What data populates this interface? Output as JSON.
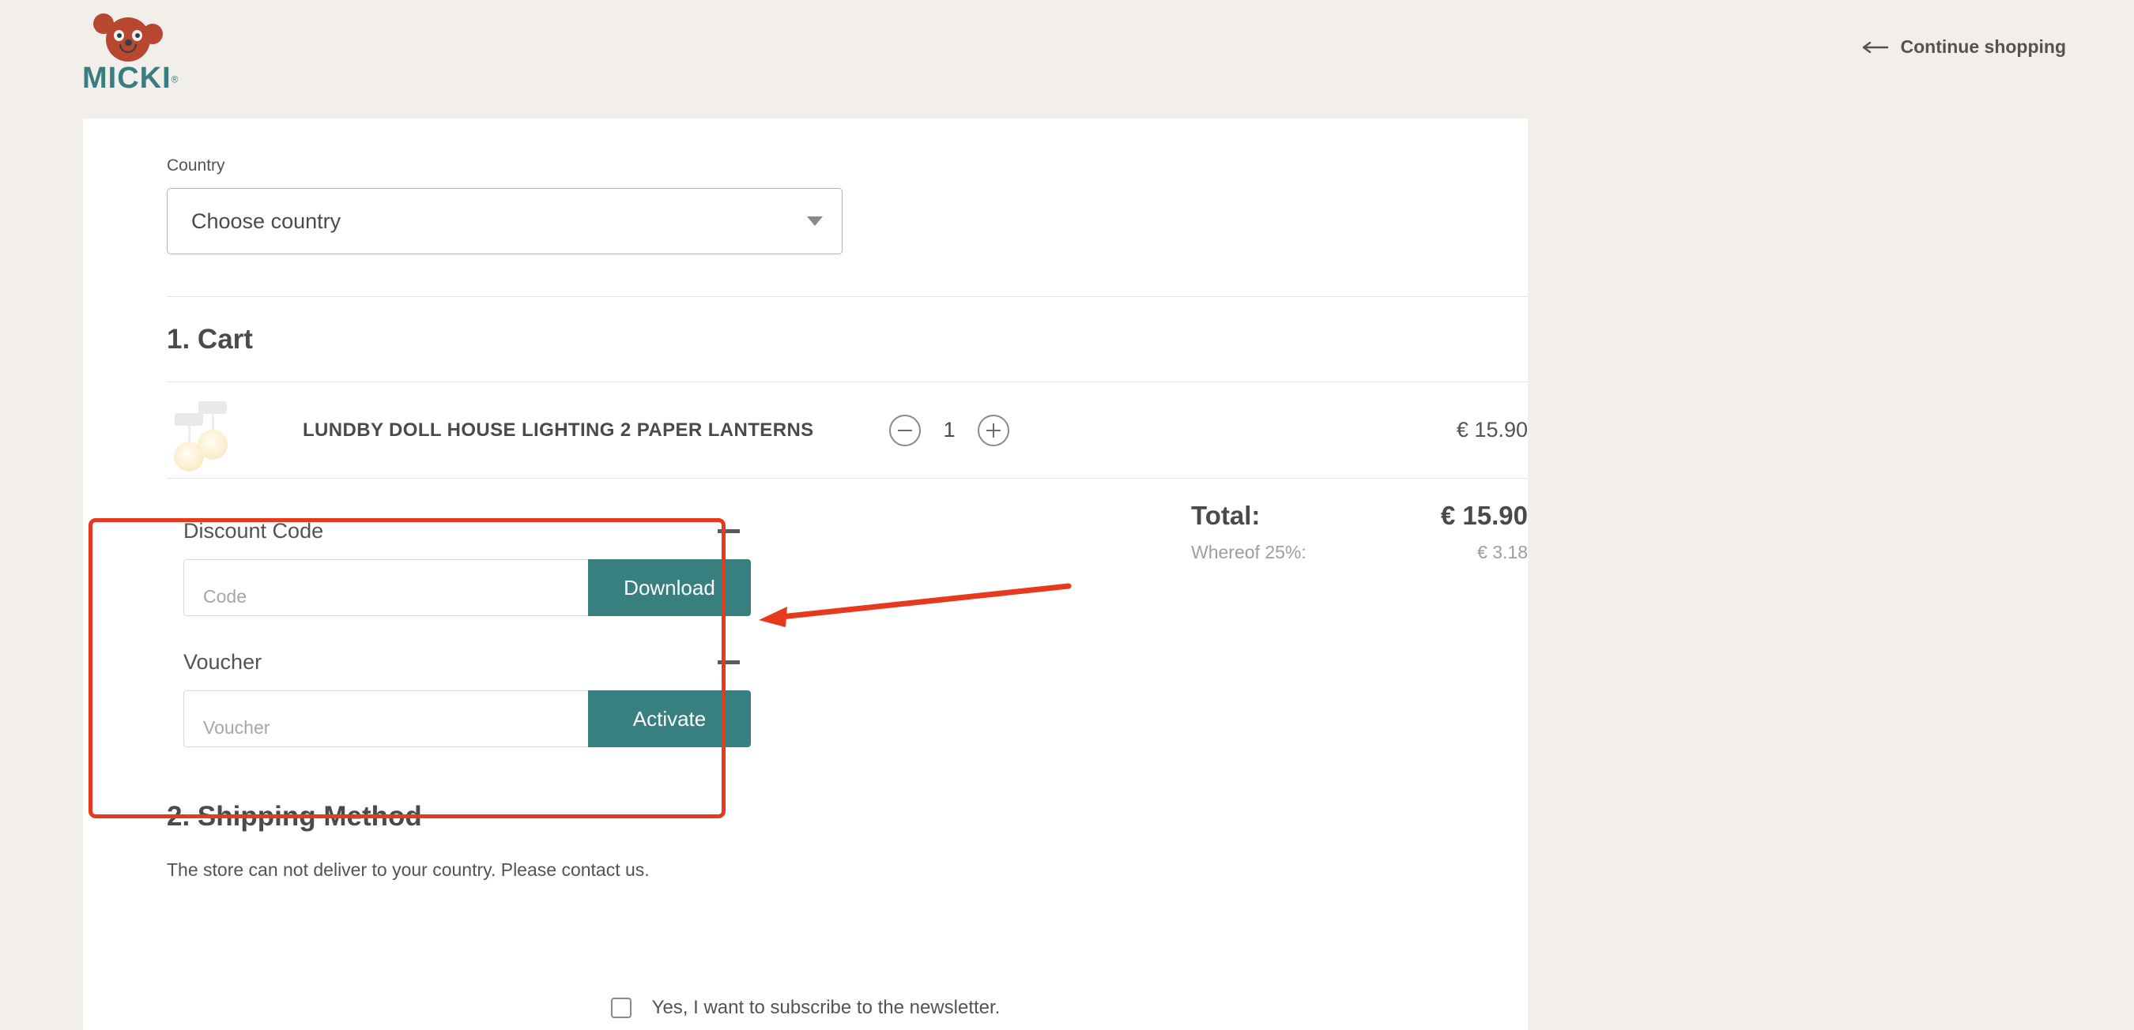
{
  "header": {
    "logo_word": "MICKI",
    "logo_tm": "®",
    "logo_alt": "micki-bear-logo",
    "continue_shopping": "Continue shopping"
  },
  "country": {
    "label": "Country",
    "selected": "Choose country"
  },
  "cart": {
    "section_title": "1. Cart",
    "item": {
      "title": "LUNDBY DOLL HOUSE LIGHTING 2 PAPER LANTERNS",
      "quantity": "1",
      "price": "€ 15.90",
      "decrease_label": "−",
      "increase_label": "+"
    }
  },
  "discount": {
    "title": "Discount Code",
    "placeholder": "Code",
    "button": "Download",
    "collapse_icon": "minus-icon"
  },
  "voucher": {
    "title": "Voucher",
    "placeholder": "Voucher",
    "button": "Activate",
    "collapse_icon": "minus-icon"
  },
  "totals": {
    "total_label": "Total:",
    "total_value": "€ 15.90",
    "vat_label": "Whereof 25%:",
    "vat_value": "€ 3.18"
  },
  "shipping": {
    "section_title": "2. Shipping Method",
    "message": "The store can not deliver to your country. Please contact us."
  },
  "newsletter": {
    "label": "Yes, I want to subscribe to the newsletter.",
    "checked": false
  },
  "colors": {
    "page_background": "#F2EFEA",
    "card_background": "#FFFFFF",
    "brand_teal": "#37807F",
    "brand_red": "#B8472F",
    "annotation_red": "#E6391D",
    "text_dark": "#4A4A48",
    "text_muted": "#A09E9A"
  }
}
